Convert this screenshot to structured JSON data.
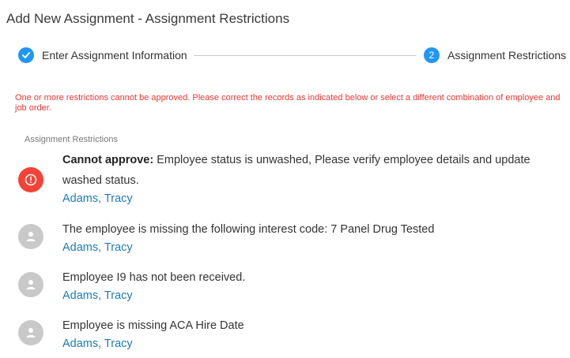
{
  "page": {
    "title": "Add New Assignment - Assignment Restrictions"
  },
  "stepper": {
    "step1": {
      "label": "Enter Assignment Information",
      "status": "complete",
      "icon": "check-icon"
    },
    "step2": {
      "number": "2",
      "label": "Assignment Restrictions",
      "status": "active"
    },
    "accent_color": "#2196f3"
  },
  "error_message": "One or more restrictions cannot be approved. Please correct the records as indicated below or select a different combination of employee and job order.",
  "section_label": "Assignment Restrictions",
  "restrictions": [
    {
      "prefix": "Cannot approve:",
      "text": " Employee status is unwashed, Please verify employee details and update washed status.",
      "link": "Adams, Tracy",
      "icon": "error-icon"
    },
    {
      "prefix": "",
      "text": "The employee is missing the following interest code: 7 Panel Drug Tested",
      "link": "Adams, Tracy",
      "icon": "person-icon"
    },
    {
      "prefix": "",
      "text": "Employee I9 has not been received.",
      "link": "Adams, Tracy",
      "icon": "person-icon"
    },
    {
      "prefix": "",
      "text": "Employee is missing ACA Hire Date",
      "link": "Adams, Tracy",
      "icon": "person-icon"
    }
  ],
  "colors": {
    "error": "#e53935",
    "link": "#1e7ab8",
    "error_icon_bg": "#f44336",
    "person_icon_bg": "#c9c9c9"
  }
}
